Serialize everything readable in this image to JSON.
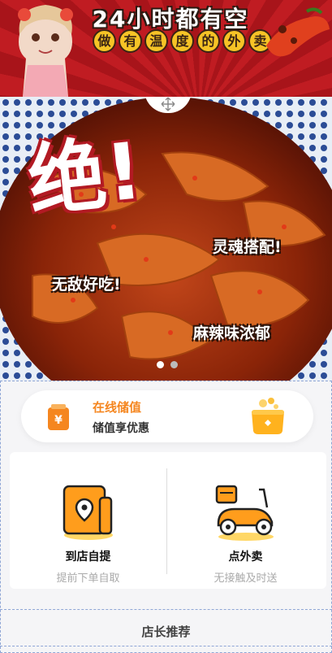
{
  "banner": {
    "headline": "24小时都有空",
    "subtitle_chars": [
      "做",
      "有",
      "温",
      "度",
      "的",
      "外",
      "卖"
    ]
  },
  "hero": {
    "big_text": "绝!",
    "tags": [
      "灵魂搭配!",
      "无敌好吃!",
      "麻辣味浓郁"
    ],
    "slides_total": 2,
    "slide_active": 1
  },
  "recharge": {
    "title": "在线储值",
    "subtitle": "储值享优惠",
    "icon": "wallet-icon",
    "decor_icon": "coin-box-icon"
  },
  "modes": [
    {
      "label": "到店自提",
      "hint": "提前下单自取",
      "icon": "store-pickup-icon"
    },
    {
      "label": "点外卖",
      "hint": "无接触及时送",
      "icon": "delivery-scooter-icon"
    }
  ],
  "section": {
    "recommend_title": "店长推荐"
  },
  "colors": {
    "accent": "#f5861f",
    "banner_red": "#c01c22",
    "badge_yellow": "#f6c326"
  }
}
